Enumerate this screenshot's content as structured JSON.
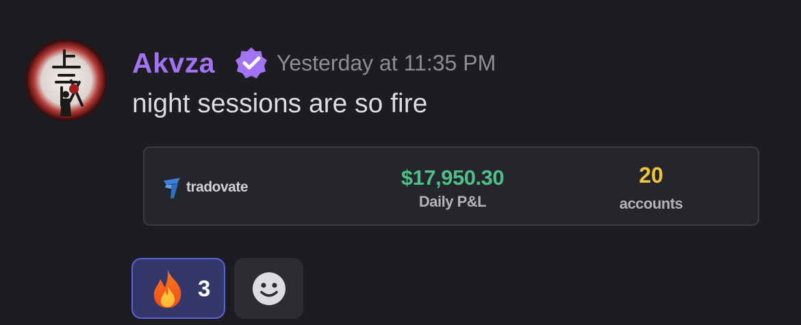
{
  "message": {
    "author": "Akvza",
    "timestamp": "Yesterday at 11:35 PM",
    "content": "night sessions are so fire",
    "author_color": "#a273f2",
    "avatar_icon": "avatar-kanji-art",
    "verified_icon": "verified-badge-icon"
  },
  "embed": {
    "brand": "tradovate",
    "brand_icon": "tradovate-logo-icon",
    "pnl_value": "$17,950.30",
    "pnl_label": "Daily P&L",
    "accounts_value": "20",
    "accounts_label": "accounts",
    "pnl_color": "#4fbf8a",
    "accounts_color": "#f0c43a"
  },
  "reactions": [
    {
      "emoji": "fire",
      "count": "3",
      "selected": true
    }
  ],
  "add_reaction_icon": "smile-face-icon"
}
